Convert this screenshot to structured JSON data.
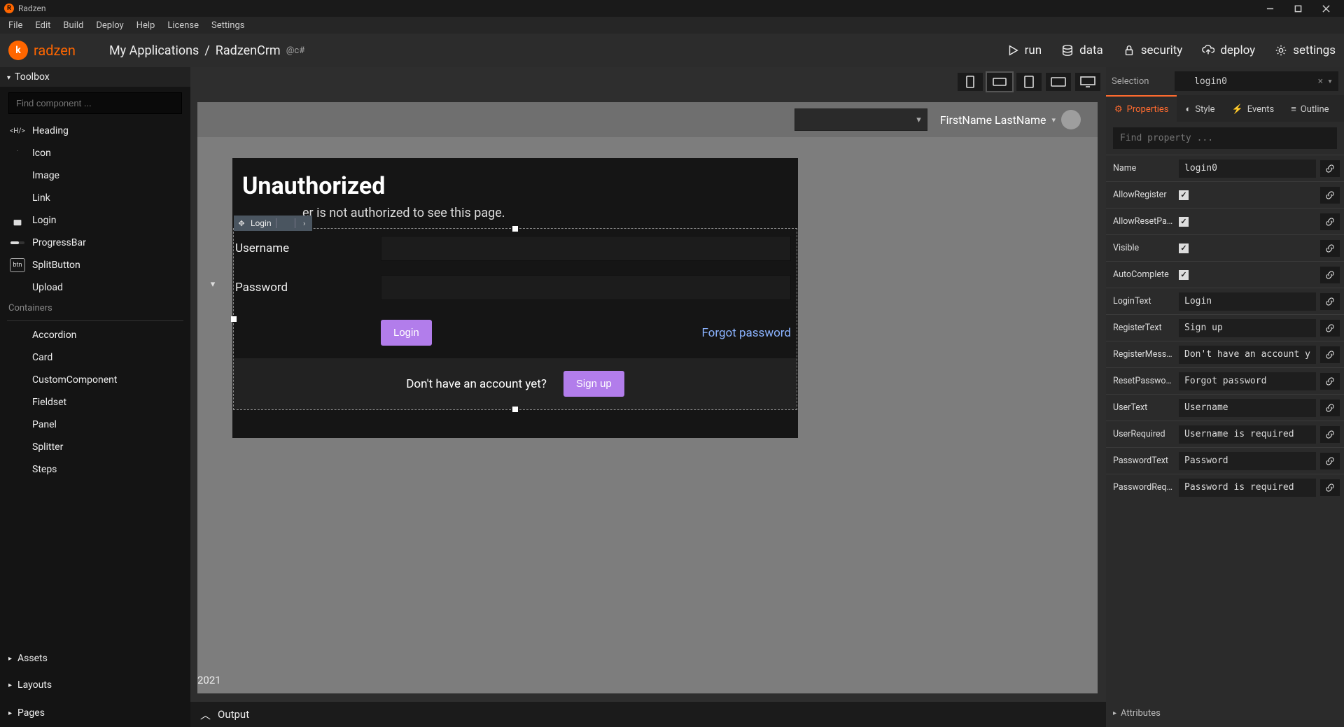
{
  "window": {
    "title": "Radzen"
  },
  "menubar": [
    "File",
    "Edit",
    "Build",
    "Deploy",
    "Help",
    "License",
    "Settings"
  ],
  "appbar": {
    "brand": "radzen",
    "breadcrumb_root": "My Applications",
    "breadcrumb_current": "RadzenCrm",
    "tech_indicator": "@c#",
    "actions": {
      "run": "run",
      "data": "data",
      "security": "security",
      "deploy": "deploy",
      "settings": "settings"
    }
  },
  "sidebar": {
    "toolbox_label": "Toolbox",
    "search_placeholder": "Find component ...",
    "components": [
      {
        "icon": "H",
        "label": "Heading"
      },
      {
        "icon": "info",
        "label": "Icon"
      },
      {
        "icon": "image",
        "label": "Image"
      },
      {
        "icon": "link",
        "label": "Link"
      },
      {
        "icon": "lock",
        "label": "Login"
      },
      {
        "icon": "progress",
        "label": "ProgressBar"
      },
      {
        "icon": "btn",
        "label": "SplitButton"
      },
      {
        "icon": "cloud",
        "label": "Upload"
      }
    ],
    "containers_label": "Containers",
    "containers": [
      {
        "label": "Accordion"
      },
      {
        "label": "Card"
      },
      {
        "label": "CustomComponent"
      },
      {
        "label": "Fieldset"
      },
      {
        "label": "Panel"
      },
      {
        "label": "Splitter"
      },
      {
        "label": "Steps"
      }
    ],
    "panels": {
      "assets": "Assets",
      "layouts": "Layouts",
      "pages": "Pages"
    }
  },
  "canvas": {
    "page_title": "Unauthorized",
    "page_subtext_partial": "er is not authorized to see this page.",
    "selected_component_label": "Login",
    "user_display": "FirstName LastName",
    "login_form": {
      "username_label": "Username",
      "password_label": "Password",
      "login_button": "Login",
      "forgot_link": "Forgot password",
      "signup_prompt": "Don't have an account yet?",
      "signup_button": "Sign up"
    },
    "footer_year": "2021",
    "output_label": "Output"
  },
  "properties": {
    "selection_label": "Selection",
    "selection_value": "login0",
    "tabs": {
      "properties": "Properties",
      "style": "Style",
      "events": "Events",
      "outline": "Outline"
    },
    "search_placeholder": "Find property ...",
    "rows": [
      {
        "name": "Name",
        "type": "text",
        "value": "login0"
      },
      {
        "name": "AllowRegister",
        "type": "bool",
        "value": "✓"
      },
      {
        "name": "AllowResetPass…",
        "type": "bool",
        "value": "✓"
      },
      {
        "name": "Visible",
        "type": "bool",
        "value": "✓"
      },
      {
        "name": "AutoComplete",
        "type": "bool",
        "value": "✓"
      },
      {
        "name": "LoginText",
        "type": "text",
        "value": "Login"
      },
      {
        "name": "RegisterText",
        "type": "text",
        "value": "Sign up"
      },
      {
        "name": "RegisterMessage…",
        "type": "text",
        "value": "Don't have an account yet?"
      },
      {
        "name": "ResetPasswordT…",
        "type": "text",
        "value": "Forgot password"
      },
      {
        "name": "UserText",
        "type": "text",
        "value": "Username"
      },
      {
        "name": "UserRequired",
        "type": "text",
        "value": "Username is required"
      },
      {
        "name": "PasswordText",
        "type": "text",
        "value": "Password"
      },
      {
        "name": "PasswordRequired",
        "type": "text",
        "value": "Password is required"
      }
    ],
    "attributes_label": "Attributes"
  }
}
